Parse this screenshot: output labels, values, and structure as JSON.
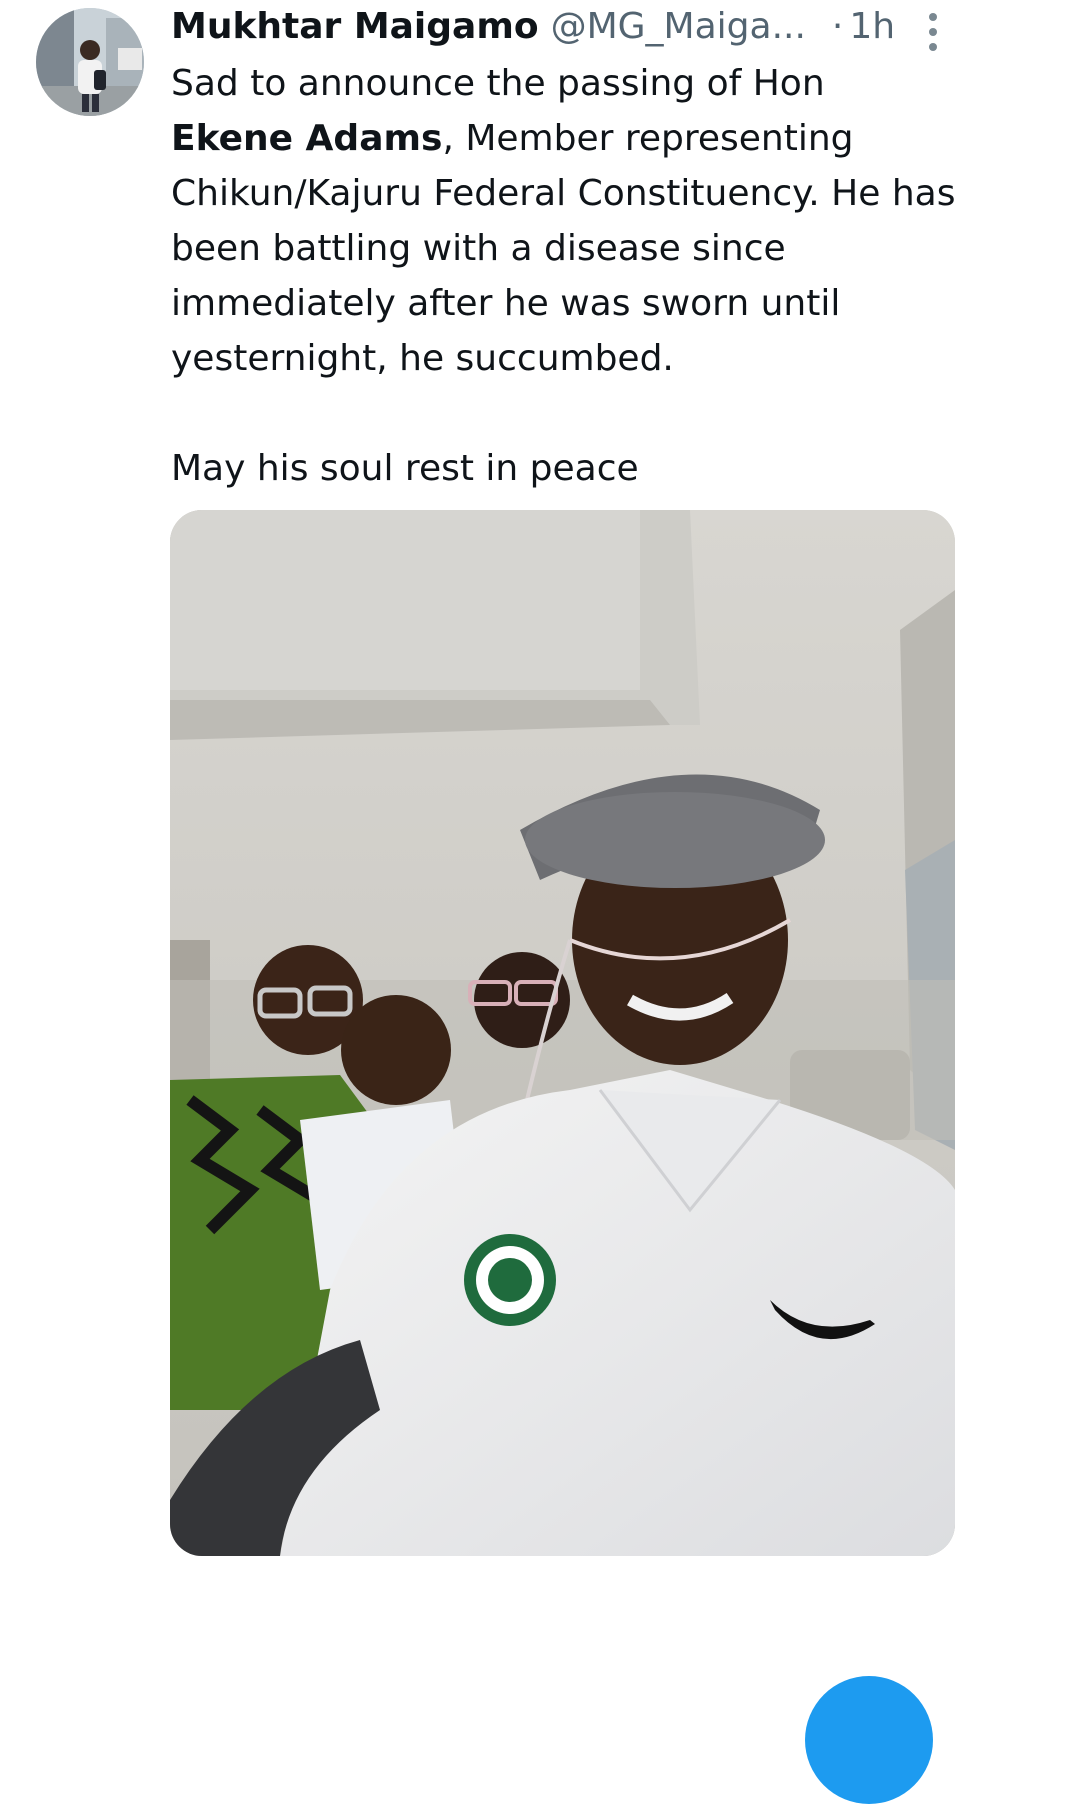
{
  "tweet": {
    "author": {
      "display_name": "Mukhtar Maigamo",
      "handle": "@MG_Maiga...",
      "avatar_icon": "user-avatar"
    },
    "separator": "·",
    "time": "1h",
    "more_icon": "more-vertical-icon",
    "text": {
      "line1_prefix": "Sad to announce the passing of Hon",
      "bold_name": "Ekene Adams",
      "line2_rest": ", Member representing Chikun/Kajuru Federal Constituency. He has been battling with a disease since immediately after he was sworn until yesternight, he succumbed.",
      "closing": "May his soul rest in peace"
    },
    "media": {
      "type": "photo",
      "icon": "photo-car-selfie"
    }
  },
  "colors": {
    "text_primary": "#0f1419",
    "text_secondary": "#536471",
    "accent": "#1d9bf0"
  },
  "fab": {
    "icon": "compose-icon"
  }
}
